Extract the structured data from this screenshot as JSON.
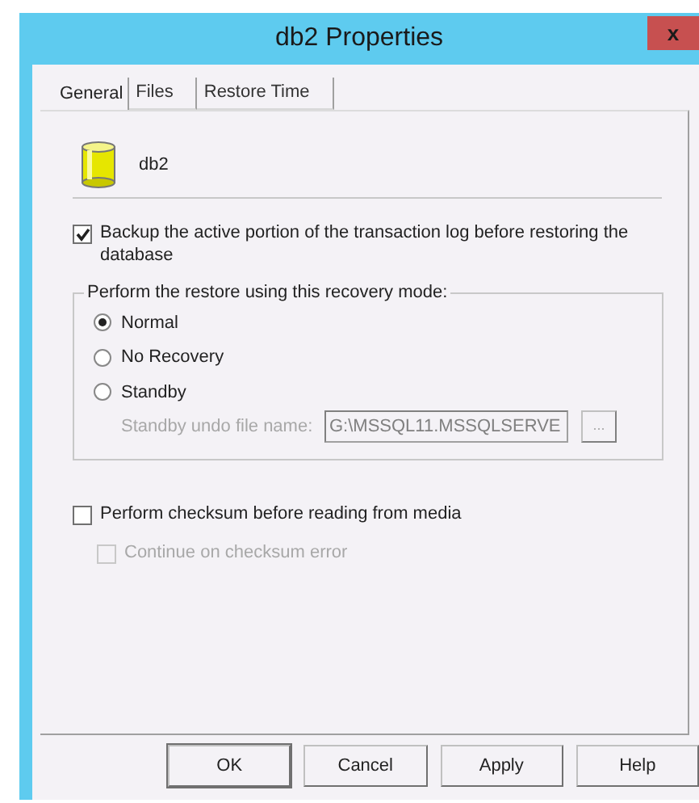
{
  "window": {
    "title": "db2 Properties",
    "close": "x"
  },
  "tabs": [
    {
      "label": "General",
      "selected": true
    },
    {
      "label": "Files",
      "selected": false
    },
    {
      "label": "Restore Time",
      "selected": false
    }
  ],
  "database": {
    "name": "db2"
  },
  "backup_log": {
    "label": "Backup the active portion of the transaction log before restoring the database",
    "checked": true,
    "disabled": false
  },
  "recovery_group": {
    "legend": "Perform the restore using this recovery mode:",
    "options": [
      {
        "label": "Normal",
        "selected": true
      },
      {
        "label": "No Recovery",
        "selected": false
      },
      {
        "label": "Standby",
        "selected": false
      }
    ],
    "standby_file": {
      "label": "Standby undo file name:",
      "value": "G:\\MSSQL11.MSSQLSERVE",
      "browse": "...",
      "disabled": true
    }
  },
  "checksum": {
    "label": "Perform checksum before reading from media",
    "checked": false,
    "disabled": false
  },
  "continue_on_error": {
    "label": "Continue on checksum error",
    "checked": false,
    "disabled": true
  },
  "buttons": [
    "OK",
    "Cancel",
    "Apply",
    "Help"
  ]
}
